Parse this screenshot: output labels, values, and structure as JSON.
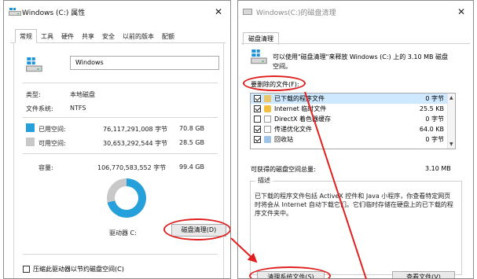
{
  "left_window": {
    "title": "Windows (C:) 属性",
    "tabs": [
      "常规",
      "工具",
      "硬件",
      "共享",
      "安全",
      "以前的版本",
      "配额"
    ],
    "active_tab": 0,
    "drive_name": "Windows",
    "type_label": "类型:",
    "type_value": "本地磁盘",
    "fs_label": "文件系统:",
    "fs_value": "NTFS",
    "used_label": "已用空间:",
    "used_bytes": "76,117,291,008 字节",
    "used_gb": "70.8 GB",
    "free_label": "可用空间:",
    "free_bytes": "30,653,292,544 字节",
    "free_gb": "28.5 GB",
    "capacity_label": "容量:",
    "capacity_bytes": "106,770,583,552 字节",
    "capacity_gb": "99.4 GB",
    "drive_label": "驱动器 C:",
    "cleanup_button": "磁盘清理(D)",
    "compress_label": "压缩此驱动器以节约磁盘空间(C)",
    "used_fraction": 0.713,
    "colors": {
      "used": "#26a0da",
      "free": "#c8c8c8"
    }
  },
  "right_window": {
    "title": "Windows(C:)的磁盘清理",
    "tab": "磁盘清理",
    "info_text": "可以使用\"磁盘清理\"来释放 Windows (C:) 上的 3.10 MB 磁盘空间。",
    "files_label": "要删除的文件(F):",
    "files": [
      {
        "name": "已下载的程序文件",
        "size": "0 字节",
        "checked": true,
        "icon": "folder-icon"
      },
      {
        "name": "Internet 临时文件",
        "size": "25.5 KB",
        "checked": true,
        "icon": "lock-icon"
      },
      {
        "name": "DirectX 着色器缓存",
        "size": "0 字节",
        "checked": false,
        "icon": "file-icon"
      },
      {
        "name": "传递优化文件",
        "size": "64.0 KB",
        "checked": true,
        "icon": "file-icon"
      },
      {
        "name": "回收站",
        "size": "0 字节",
        "checked": true,
        "icon": "recycle-bin-icon"
      }
    ],
    "total_label": "可获得的磁盘空间总量:",
    "total_value": "3.10 MB",
    "desc_title": "描述",
    "desc_text": "已下载的程序文件包括 ActiveX 控件和 Java 小程序，你查看特定网页时将会从 Internet 自动下载它们。它们临时存储在硬盘上的已下载的程序文件夹中。",
    "clean_system_button": "清理系统文件(S)",
    "view_files_button": "查看文件(V)"
  },
  "annotation_color": "#e02020"
}
